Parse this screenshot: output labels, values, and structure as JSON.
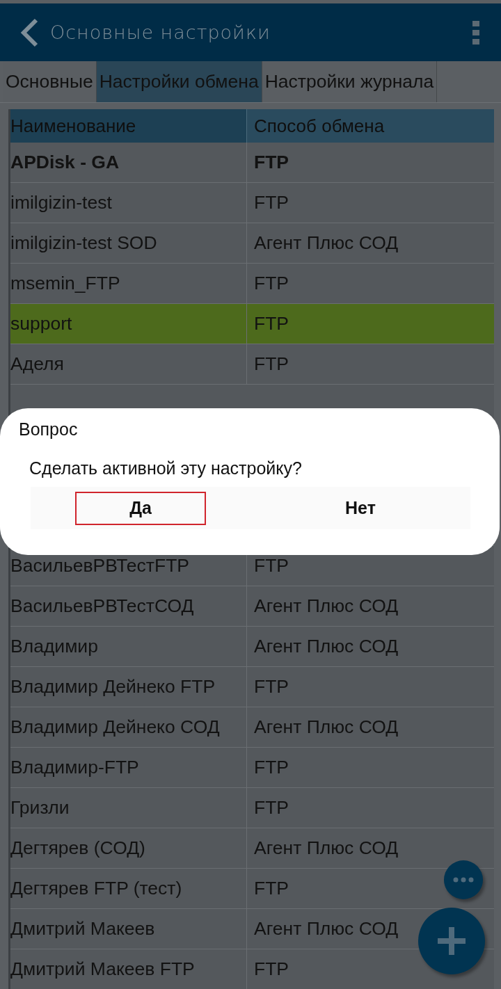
{
  "app_bar": {
    "title": "Основные настройки"
  },
  "tabs": [
    {
      "label": "Основные",
      "selected": false
    },
    {
      "label": "Настройки обмена",
      "selected": true
    },
    {
      "label": "Настройки журнала",
      "selected": false
    }
  ],
  "table": {
    "columns": [
      "Наименование",
      "Способ обмена"
    ],
    "rows_above_dialog": [
      {
        "cells": [
          "APDisk - GA",
          "FTP"
        ],
        "active": true,
        "selected": false
      },
      {
        "cells": [
          "imilgizin-test",
          "FTP"
        ],
        "active": false,
        "selected": false
      },
      {
        "cells": [
          "imilgizin-test SOD",
          "Агент Плюс СОД"
        ],
        "active": false,
        "selected": false
      },
      {
        "cells": [
          "msemin_FTP",
          "FTP"
        ],
        "active": false,
        "selected": false
      },
      {
        "cells": [
          "support",
          "FTP"
        ],
        "active": false,
        "selected": true
      },
      {
        "cells": [
          "Аделя",
          "FTP"
        ],
        "active": false,
        "selected": false
      }
    ],
    "rows_below_dialog": [
      {
        "cells": [
          "ВасильевРВТестFTP",
          "FTP"
        ],
        "active": false,
        "selected": false
      },
      {
        "cells": [
          "ВасильевРВТестСОД",
          "Агент Плюс СОД"
        ],
        "active": false,
        "selected": false
      },
      {
        "cells": [
          "Владимир",
          "Агент Плюс СОД"
        ],
        "active": false,
        "selected": false
      },
      {
        "cells": [
          "Владимир Дейнеко FTP",
          "FTP"
        ],
        "active": false,
        "selected": false
      },
      {
        "cells": [
          "Владимир Дейнеко СОД",
          "Агент Плюс СОД"
        ],
        "active": false,
        "selected": false
      },
      {
        "cells": [
          "Владимир-FTP",
          "FTP"
        ],
        "active": false,
        "selected": false
      },
      {
        "cells": [
          "Гризли",
          "FTP"
        ],
        "active": false,
        "selected": false
      },
      {
        "cells": [
          "Дегтярев (СОД)",
          "Агент Плюс СОД"
        ],
        "active": false,
        "selected": false
      },
      {
        "cells": [
          "Дегтярев FTP (тест)",
          "FTP"
        ],
        "active": false,
        "selected": false
      },
      {
        "cells": [
          "Дмитрий Макеев",
          "Агент Плюс СОД"
        ],
        "active": false,
        "selected": false
      },
      {
        "cells": [
          "Дмитрий Макеев FTP",
          "FTP"
        ],
        "active": false,
        "selected": false
      }
    ]
  },
  "dialog": {
    "title": "Вопрос",
    "message": "Сделать активной эту настройку?",
    "buttons": [
      {
        "label": "Да",
        "focused": true
      },
      {
        "label": "Нет",
        "focused": false
      }
    ]
  }
}
